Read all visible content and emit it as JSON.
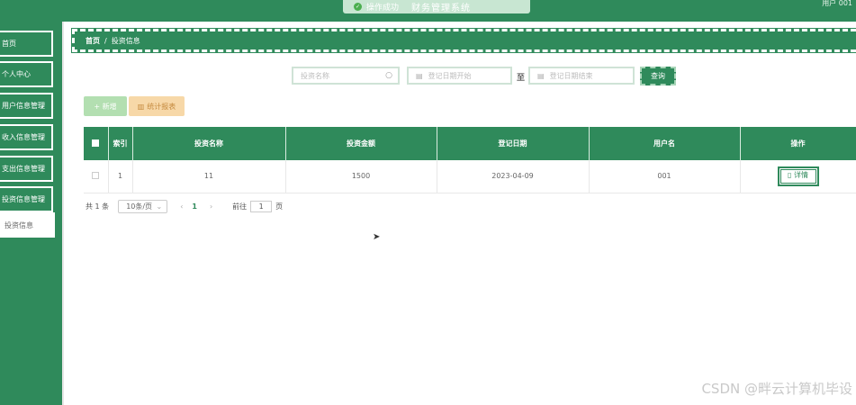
{
  "toast": {
    "message": "操作成功",
    "app_title": "财务管理系统"
  },
  "header": {
    "user": "用户 001"
  },
  "sidebar": {
    "items": [
      {
        "label": "首页"
      },
      {
        "label": "个人中心"
      },
      {
        "label": "用户信息管理"
      },
      {
        "label": "收入信息管理"
      },
      {
        "label": "支出信息管理"
      },
      {
        "label": "投资信息管理"
      }
    ],
    "active_sub": "投资信息"
  },
  "breadcrumb": {
    "home": "首页",
    "sep": "/",
    "current": "投资信息"
  },
  "search": {
    "name_placeholder": "投资名称",
    "date_start_placeholder": "登记日期开始",
    "date_end_placeholder": "登记日期结束",
    "range_sep": "至",
    "query_label": "查询"
  },
  "actions": {
    "add_label": "+ 新增",
    "report_label": "统计报表"
  },
  "table": {
    "columns": [
      "索引",
      "投资名称",
      "投资金额",
      "登记日期",
      "用户名",
      "操作"
    ],
    "rows": [
      {
        "index": "1",
        "name": "11",
        "amount": "1500",
        "date": "2023-04-09",
        "user": "001",
        "action": "详情"
      }
    ]
  },
  "pagination": {
    "total": "共 1 条",
    "page_size": "10条/页",
    "prev": "‹",
    "current": "1",
    "next": "›",
    "goto_prefix": "前往",
    "goto_value": "1",
    "goto_suffix": "页"
  },
  "watermark": "CSDN @畔云计算机毕设"
}
